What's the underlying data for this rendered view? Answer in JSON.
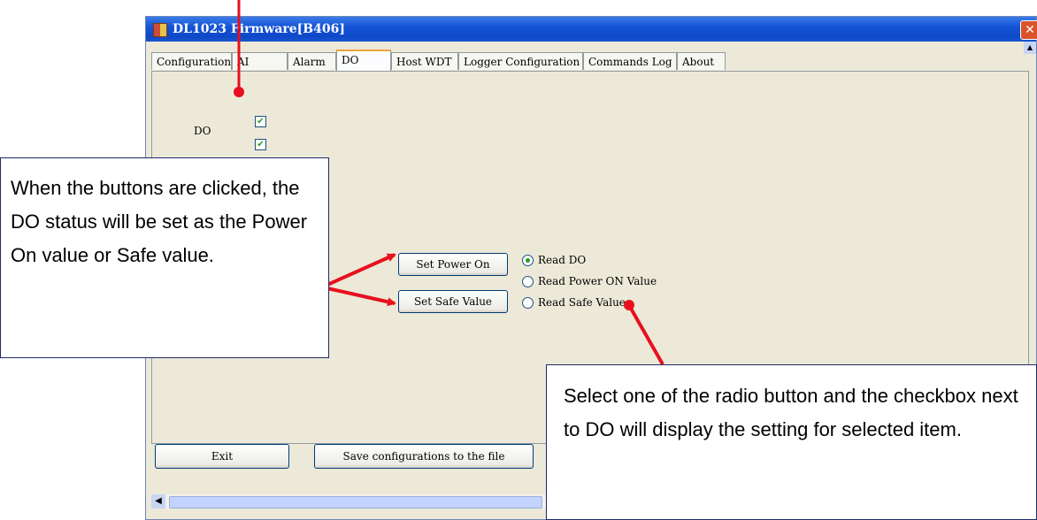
{
  "window": {
    "title": "DL1023 Firmware[B406]",
    "close_glyph": "✕"
  },
  "tabs": [
    {
      "label": "Configuration"
    },
    {
      "label": "AI"
    },
    {
      "label": "Alarm"
    },
    {
      "label": "DO"
    },
    {
      "label": "Host WDT"
    },
    {
      "label": "Logger Configuration"
    },
    {
      "label": "Commands Log"
    },
    {
      "label": "About"
    }
  ],
  "active_tab": "DO",
  "do_panel": {
    "do_label": "DO",
    "checkboxes": [
      {
        "checked": true
      },
      {
        "checked": true
      }
    ],
    "buttons": {
      "set_power_on": "Set Power On",
      "set_safe_value": "Set Safe Value"
    },
    "radios": [
      {
        "label": "Read DO",
        "selected": true
      },
      {
        "label": "Read Power ON Value",
        "selected": false
      },
      {
        "label": "Read Safe Value",
        "selected": false
      }
    ]
  },
  "footer": {
    "exit_label": "Exit",
    "save_label": "Save configurations to the file"
  },
  "callouts": {
    "left_text": "When the buttons are clicked, the DO status will be set as the Power On value or Safe value.",
    "right_text": "Select one of the radio button and the checkbox next to DO will display the setting for selected item."
  },
  "colors": {
    "arrow": "#e8101e",
    "titlebar": "#1554d6",
    "window_bg": "#ece9d8",
    "check_green": "#21a121"
  },
  "icons": {
    "check": "✔",
    "scroll_up": "▲",
    "scroll_left": "◀"
  }
}
